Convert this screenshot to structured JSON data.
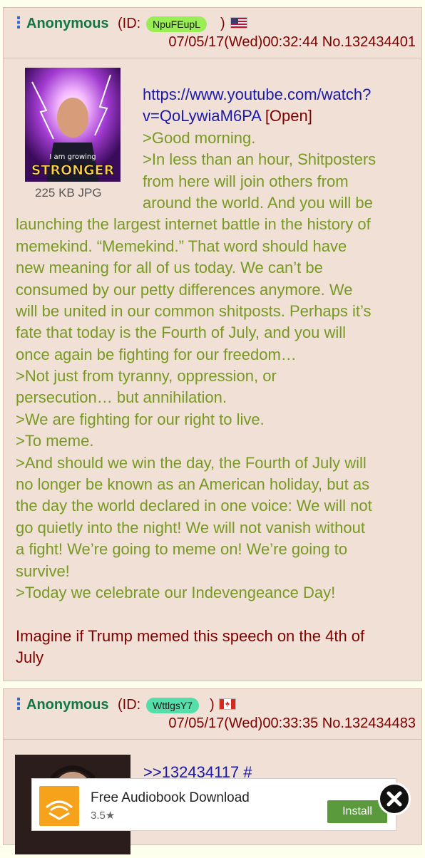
{
  "posts": [
    {
      "name": "Anonymous",
      "id_label": "(ID:",
      "id": "NpuFEupL",
      "id_color": "#99ee55",
      "flag": "us-flag",
      "datetime": "07/05/17(Wed)00:32:44",
      "number": "No.132434401",
      "thumbnail_text": [
        "I am growing",
        "STRONGER"
      ],
      "file_info": "225 KB JPG",
      "body": {
        "lines": [
          "https://www.youtube.com/watch?",
          "v=QoLywiaM6PA",
          ">Good morning.",
          ">In less than an hour, Shitposters",
          "from here will join others from",
          "around the world. And you will be",
          "launching the largest internet battle in the history of",
          "memekind. “Memekind.” That word should have",
          "new meaning for all of us today. We can’t be",
          "consumed by our petty differences anymore. We",
          "will be united in our common shitposts. Perhaps it’s",
          "fate that today is the Fourth of July, and you will",
          "once again be fighting for our freedom…",
          ">Not just from tyranny, oppression, or",
          "persecution… but annihilation.",
          ">We are fighting for our right to live.",
          ">To meme.",
          ">And should we win the day, the Fourth of July will",
          "no longer be known as an American holiday, but as",
          "the day the world declared in one voice: We will not",
          "go quietly into the night! We will not vanish without",
          "a fight! We’re going to meme on! We’re going to",
          "survive!",
          ">Today we celebrate our Indevengeance Day!",
          "Imagine if Trump memed this speech on the 4th of",
          "July"
        ],
        "open_label": "[Open]"
      }
    },
    {
      "name": "Anonymous",
      "id_label": "(ID:",
      "id": "WttlgsY7",
      "id_color": "#55ddaa",
      "flag": "canada-flag",
      "datetime": "07/05/17(Wed)00:33:35",
      "number": "No.132434483",
      "reply_link": ">>132434117 #"
    }
  ],
  "ad": {
    "title": "Free Audiobook Download",
    "rating": "3.5★",
    "install_label": "Install",
    "icon": "audible-icon"
  },
  "colors": {
    "post_bg": "#f0e0d6",
    "page_bg": "#ffffee",
    "name": "#117743",
    "quote": "#789922",
    "text": "#800000",
    "link": "#1a1aa6"
  }
}
